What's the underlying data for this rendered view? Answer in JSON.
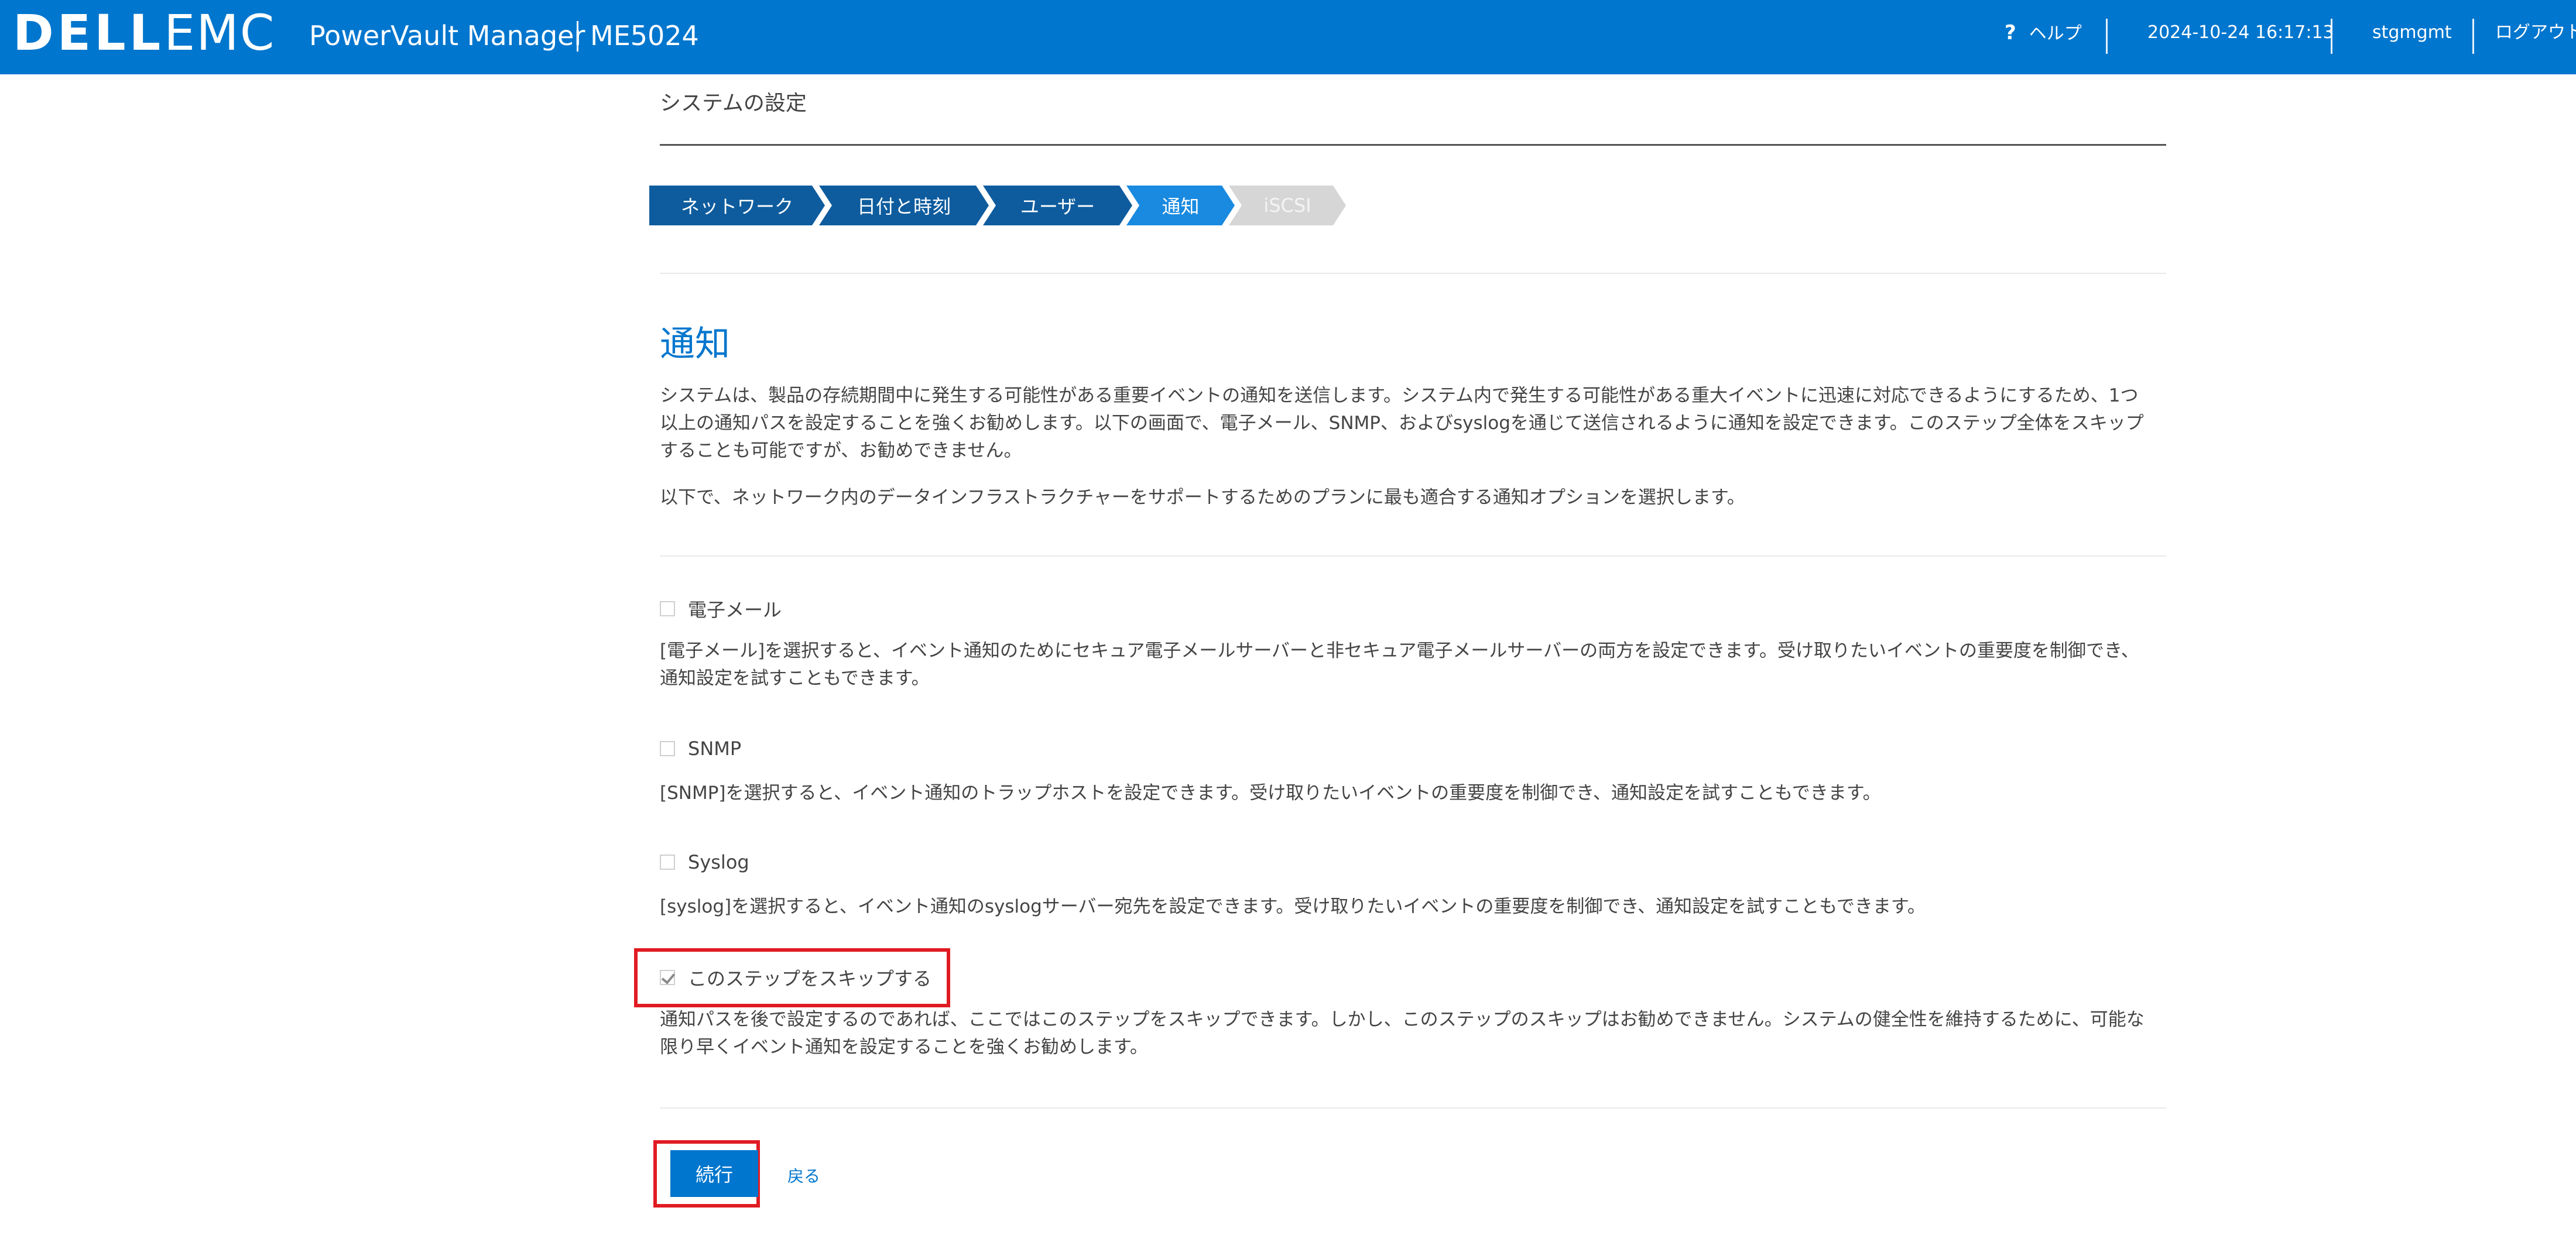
{
  "header": {
    "logo": {
      "dell": "DELL",
      "emc": "EMC"
    },
    "app_title": "PowerVault Manager",
    "model": "ME5024",
    "help_icon": "?",
    "help_label": "ヘルプ",
    "datetime": "2024-10-24 16:17:13",
    "user": "stgmgmt",
    "logout_label": "ログアウト"
  },
  "page": {
    "title": "システムの設定"
  },
  "wizard": {
    "steps": [
      {
        "label": "ネットワーク",
        "state": "done"
      },
      {
        "label": "日付と時刻",
        "state": "done"
      },
      {
        "label": "ユーザー",
        "state": "done"
      },
      {
        "label": "通知",
        "state": "active"
      },
      {
        "label": "iSCSI",
        "state": "inactive"
      }
    ]
  },
  "section": {
    "heading": "通知",
    "intro_line1": "システムは、製品の存続期間中に発生する可能性がある重要イベントの通知を送信します。システム内で発生する可能性がある重大イベントに迅速に対応できるようにするため、1つ",
    "intro_line2": "以上の通知パスを設定することを強くお勧めします。以下の画面で、電子メール、SNMP、およびsyslogを通じて送信されるように通知を設定できます。このステップ全体をスキップ",
    "intro_line3": "することも可能ですが、お勧めできません。",
    "intro2": "以下で、ネットワーク内のデータインフラストラクチャーをサポートするためのプランに最も適合する通知オプションを選択します。"
  },
  "options": {
    "email": {
      "label": "電子メール",
      "checked": false,
      "desc_line1": "[電子メール]を選択すると、イベント通知のためにセキュア電子メールサーバーと非セキュア電子メールサーバーの両方を設定できます。受け取りたいイベントの重要度を制御でき、",
      "desc_line2": "通知設定を試すこともできます。"
    },
    "snmp": {
      "label": "SNMP",
      "checked": false,
      "desc": "[SNMP]を選択すると、イベント通知のトラップホストを設定できます。受け取りたいイベントの重要度を制御でき、通知設定を試すこともできます。"
    },
    "syslog": {
      "label": "Syslog",
      "checked": false,
      "desc": "[syslog]を選択すると、イベント通知のsyslogサーバー宛先を設定できます。受け取りたいイベントの重要度を制御でき、通知設定を試すこともできます。"
    },
    "skip": {
      "label": "このステップをスキップする",
      "checked": true,
      "desc_line1": "通知パスを後で設定するのであれば、ここではこのステップをスキップできます。しかし、このステップのスキップはお勧めできません。システムの健全性を維持するために、可能な",
      "desc_line2": "限り早くイベント通知を設定することを強くお勧めします。"
    }
  },
  "actions": {
    "continue_label": "続行",
    "back_label": "戻る"
  },
  "colors": {
    "header_bg": "#0076ce",
    "accent": "#0076ce",
    "step_done": "#0e5c9e",
    "step_active": "#1a8ae0",
    "step_inactive": "#d6d6d6",
    "highlight": "#e01b22"
  }
}
